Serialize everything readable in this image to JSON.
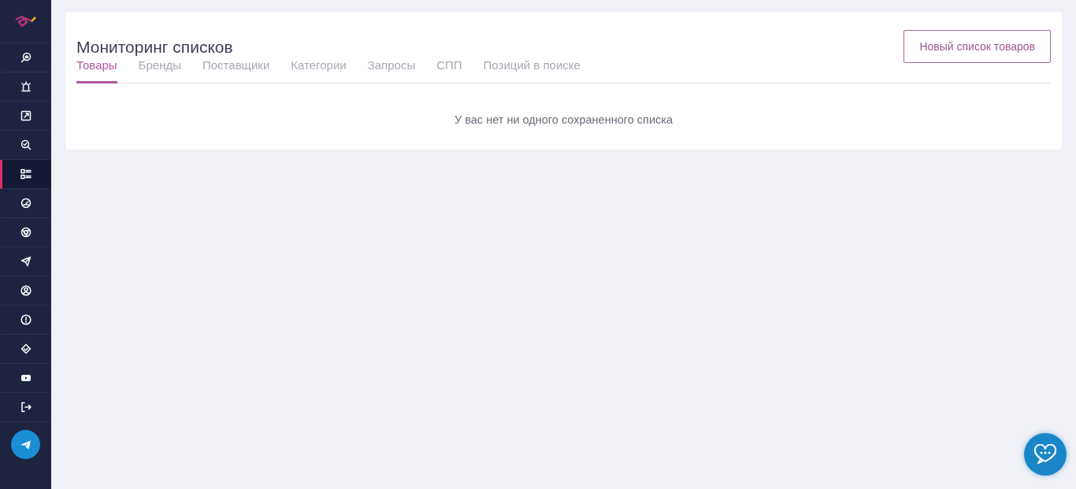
{
  "sidebar": {
    "items": [
      {
        "kind": "analytics",
        "selected": false
      },
      {
        "kind": "alarm",
        "selected": false
      },
      {
        "kind": "edit",
        "selected": false
      },
      {
        "kind": "search",
        "selected": false
      },
      {
        "kind": "list",
        "selected": true
      },
      {
        "kind": "gauge",
        "selected": false
      },
      {
        "kind": "browser",
        "selected": false
      },
      {
        "kind": "send",
        "selected": false
      },
      {
        "kind": "user",
        "selected": false
      },
      {
        "kind": "alert",
        "selected": false
      },
      {
        "kind": "partner",
        "selected": false
      },
      {
        "kind": "video",
        "selected": false
      },
      {
        "kind": "logout",
        "selected": false
      }
    ]
  },
  "page": {
    "title": "Мониторинг списков",
    "new_button": "Новый список товаров",
    "tabs": [
      {
        "label": "Товары",
        "selected": true
      },
      {
        "label": "Бренды",
        "selected": false
      },
      {
        "label": "Поставщики",
        "selected": false
      },
      {
        "label": "Категории",
        "selected": false
      },
      {
        "label": "Запросы",
        "selected": false
      },
      {
        "label": "СПП",
        "selected": false
      },
      {
        "label": "Позиций в поиске",
        "selected": false
      }
    ],
    "empty_message": "У вас нет ни одного сохраненного списка"
  }
}
